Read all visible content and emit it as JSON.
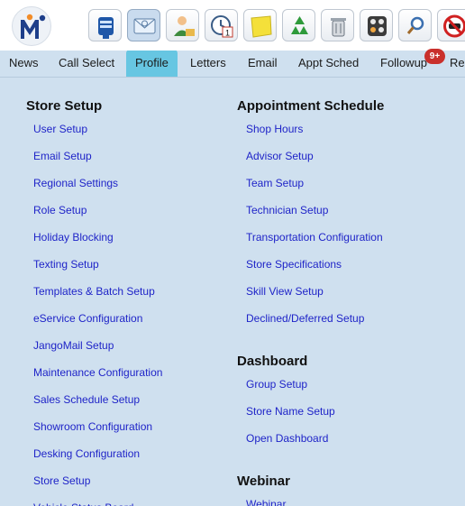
{
  "toolbar": {
    "logo": "M",
    "tools": [
      {
        "icon": "mailbox-icon"
      },
      {
        "icon": "email-envelope-icon",
        "active": true
      },
      {
        "icon": "contact-person-icon"
      },
      {
        "icon": "calendar-clock-icon",
        "text": "1"
      },
      {
        "icon": "sticky-note-icon"
      },
      {
        "icon": "recycle-icon"
      },
      {
        "icon": "trash-can-icon"
      },
      {
        "icon": "dashboard-grid-icon"
      },
      {
        "icon": "search-magnifier-icon"
      },
      {
        "icon": "no-car-icon"
      }
    ]
  },
  "tabs": {
    "news": "News",
    "call_select": "Call Select",
    "profile": "Profile",
    "letters": "Letters",
    "email": "Email",
    "appt_sched": "Appt Sched",
    "followup": "Followup",
    "followup_badge": "9+",
    "rep": "Rep"
  },
  "store_setup": {
    "title": "Store Setup",
    "links": [
      "User Setup",
      "Email Setup",
      "Regional Settings",
      "Role Setup",
      "Holiday Blocking",
      "Texting Setup",
      "Templates & Batch Setup",
      "eService Configuration",
      "JangoMail Setup",
      "Maintenance Configuration",
      "Sales Schedule Setup",
      "Showroom Configuration",
      "Desking Configuration",
      "Store Setup",
      "Vehicle Status Board"
    ]
  },
  "appointment_schedule": {
    "title": "Appointment Schedule",
    "links": [
      "Shop Hours",
      "Advisor Setup",
      "Team Setup",
      "Technician Setup",
      "Transportation Configuration",
      "Store Specifications",
      "Skill View Setup",
      "Declined/Deferred Setup"
    ]
  },
  "dashboard": {
    "title": "Dashboard",
    "links": [
      "Group Setup",
      "Store Name Setup",
      "Open Dashboard"
    ]
  },
  "webinar": {
    "title": "Webinar",
    "links": [
      "Webinar"
    ]
  },
  "colors": {
    "page_bg": "#cfe0ef",
    "active_tab": "#67c6e2",
    "link": "#1f24c8",
    "badge": "#c9302c"
  }
}
